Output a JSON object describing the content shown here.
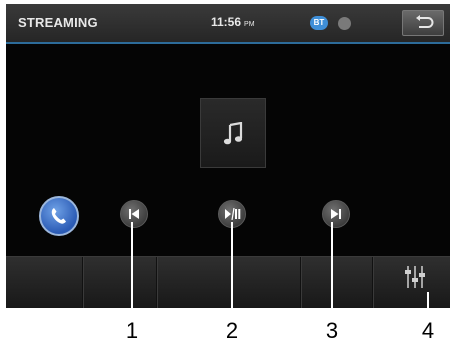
{
  "header": {
    "title": "STREAMING",
    "time": "11:56",
    "ampm": "PM",
    "bt_badge": "BT"
  },
  "album_art": {
    "icon": "music-note-icon"
  },
  "controls": [
    {
      "icon": "phone-icon"
    },
    {
      "icon": "previous-track-icon"
    },
    {
      "icon": "play-pause-icon"
    },
    {
      "icon": "next-track-icon"
    }
  ],
  "bottombar": {
    "eq_icon": "equalizer-icon"
  },
  "callouts": [
    "1",
    "2",
    "3",
    "4"
  ],
  "colors": {
    "accent": "#2d6c9a",
    "bt": "#3f8fd8",
    "phone": "#2b5bb5"
  }
}
